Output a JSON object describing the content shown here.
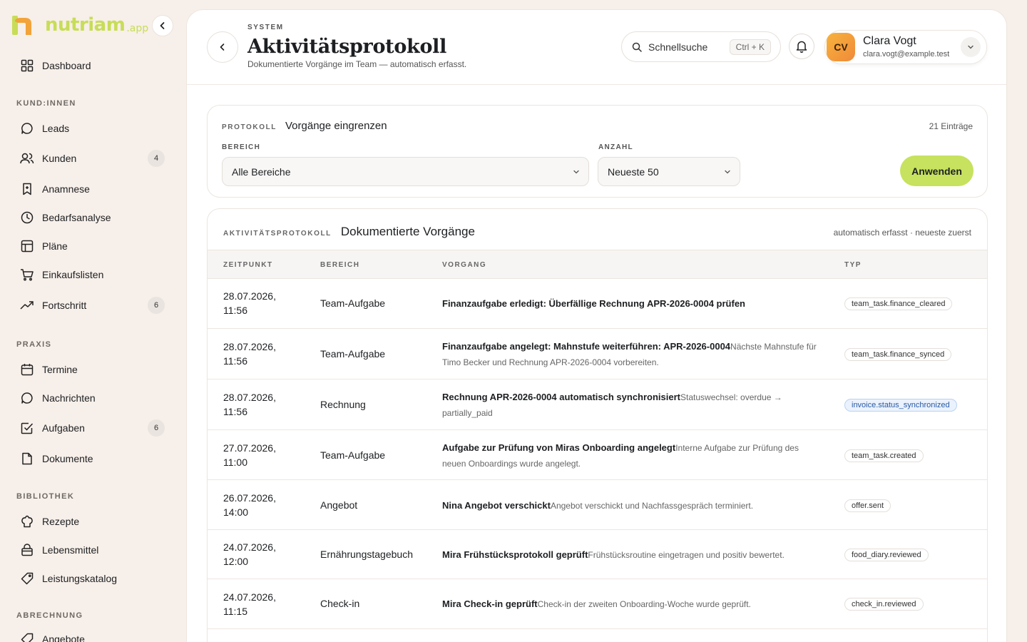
{
  "brand": {
    "word": "nutriam",
    "suffix": ".app"
  },
  "sidebar": {
    "dashboard": "Dashboard",
    "sections": [
      {
        "label": "KUND:INNEN"
      },
      {
        "label": "PRAXIS"
      },
      {
        "label": "BIBLIOTHEK"
      },
      {
        "label": "ABRECHNUNG"
      }
    ],
    "items": [
      {
        "label": "Leads",
        "icon": "chat-bubble-icon"
      },
      {
        "label": "Kunden",
        "icon": "users-icon",
        "badge": "4"
      },
      {
        "label": "Anamnese",
        "icon": "bookmark-plus-icon"
      },
      {
        "label": "Bedarfsanalyse",
        "icon": "clock-icon"
      },
      {
        "label": "Pläne",
        "icon": "table-icon"
      },
      {
        "label": "Einkaufslisten",
        "icon": "cart-icon"
      },
      {
        "label": "Fortschritt",
        "icon": "trend-up-icon",
        "badge": "6"
      },
      {
        "label": "Termine",
        "icon": "calendar-icon"
      },
      {
        "label": "Nachrichten",
        "icon": "message-icon"
      },
      {
        "label": "Aufgaben",
        "icon": "checkbox-icon",
        "badge": "6"
      },
      {
        "label": "Dokumente",
        "icon": "document-icon"
      },
      {
        "label": "Rezepte",
        "icon": "chef-hat-icon"
      },
      {
        "label": "Lebensmittel",
        "icon": "bag-icon"
      },
      {
        "label": "Leistungskatalog",
        "icon": "tag-icon"
      },
      {
        "label": "Angebote",
        "icon": "offer-icon"
      }
    ]
  },
  "header": {
    "crumb": "SYSTEM",
    "title": "Aktivitätsprotokoll",
    "subtitle": "Dokumentierte Vorgänge im Team — automatisch erfasst.",
    "search_label": "Schnellsuche",
    "search_shortcut": "Ctrl + K",
    "user": {
      "initials": "CV",
      "name": "Clara Vogt",
      "email": "clara.vogt@example.test"
    }
  },
  "filter": {
    "eyebrow": "PROTOKOLL",
    "title": "Vorgänge eingrenzen",
    "count": "21 Einträge",
    "area_label": "BEREICH",
    "area_value": "Alle Bereiche",
    "amount_label": "ANZAHL",
    "amount_value": "Neueste 50",
    "apply": "Anwenden"
  },
  "table": {
    "eyebrow": "AKTIVITÄTSPROTOKOLL",
    "title": "Dokumentierte Vorgänge",
    "note": "automatisch erfasst · neueste zuerst",
    "columns": [
      "ZEITPUNKT",
      "BEREICH",
      "VORGANG",
      "TYP"
    ],
    "rows": [
      {
        "date": "28.07.2026,",
        "time": "11:56",
        "area": "Team-Aufgabe",
        "title": "Finanzaufgabe erledigt: Überfällige Rechnung APR-2026-0004 prüfen",
        "detail": "",
        "type": "team_task.finance_cleared",
        "highlight": false
      },
      {
        "date": "28.07.2026,",
        "time": "11:56",
        "area": "Team-Aufgabe",
        "title": "Finanzaufgabe angelegt: Mahnstufe weiterführen: APR-2026-0004",
        "detail": "Nächste Mahnstufe für Timo Becker und Rechnung APR-2026-0004 vorbereiten.",
        "type": "team_task.finance_synced",
        "highlight": false
      },
      {
        "date": "28.07.2026,",
        "time": "11:56",
        "area": "Rechnung",
        "title": "Rechnung APR-2026-0004 automatisch synchronisiert",
        "detail": "Statuswechsel: overdue → partially_paid",
        "type": "invoice.status_synchronized",
        "highlight": true
      },
      {
        "date": "27.07.2026,",
        "time": "11:00",
        "area": "Team-Aufgabe",
        "title": "Aufgabe zur Prüfung von Miras Onboarding angelegt",
        "detail": "Interne Aufgabe zur Prüfung des neuen Onboardings wurde angelegt.",
        "type": "team_task.created",
        "highlight": false
      },
      {
        "date": "26.07.2026,",
        "time": "14:00",
        "area": "Angebot",
        "title": "Nina Angebot verschickt",
        "detail": "Angebot verschickt und Nachfassgespräch terminiert.",
        "type": "offer.sent",
        "highlight": false
      },
      {
        "date": "24.07.2026,",
        "time": "12:00",
        "area": "Ernährungstagebuch",
        "title": "Mira Frühstücksprotokoll geprüft",
        "detail": "Frühstücksroutine eingetragen und positiv bewertet.",
        "type": "food_diary.reviewed",
        "highlight": false
      },
      {
        "date": "24.07.2026,",
        "time": "11:15",
        "area": "Check-in",
        "title": "Mira Check-in geprüft",
        "detail": "Check-in der zweiten Onboarding-Woche wurde geprüft.",
        "type": "check_in.reviewed",
        "highlight": false
      }
    ]
  },
  "colors": {
    "accent": "#c6e25e",
    "brand": "#c7dd57",
    "avatar": "#f7b23c",
    "highlight_tag": "#2a5aa0"
  }
}
